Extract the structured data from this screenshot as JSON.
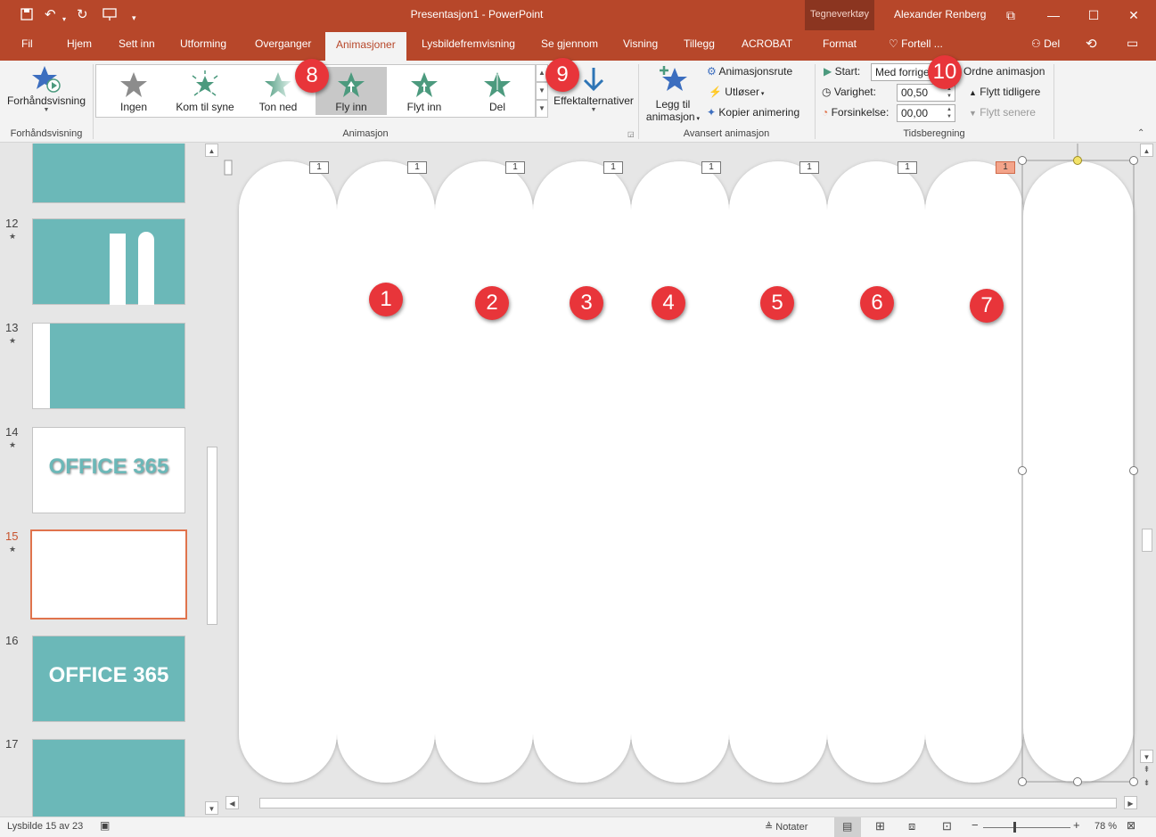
{
  "window": {
    "title": "Presentasjon1  -  PowerPoint",
    "context_group": "Tegneverktøy",
    "user": "Alexander Renberg"
  },
  "tabs": [
    "Fil",
    "Hjem",
    "Sett inn",
    "Utforming",
    "Overganger",
    "Animasjoner",
    "Lysbildefremvisning",
    "Se gjennom",
    "Visning",
    "Tillegg",
    "ACROBAT",
    "Format"
  ],
  "active_tab": "Animasjoner",
  "tell_me": "Fortell ...",
  "share": "Del",
  "ribbon": {
    "preview": {
      "label": "Forhåndsvisning",
      "group": "Forhåndsvisning"
    },
    "animation": {
      "group": "Animasjon",
      "gallery": [
        {
          "label": "Ingen",
          "color": "#8c8c8c"
        },
        {
          "label": "Kom til syne",
          "color": "#4c9a7e"
        },
        {
          "label": "Ton ned",
          "color": "#9fcab8"
        },
        {
          "label": "Fly inn",
          "color": "#4c9a7e"
        },
        {
          "label": "Flyt inn",
          "color": "#4c9a7e"
        },
        {
          "label": "Del",
          "color": "#4c9a7e"
        }
      ],
      "selected": "Fly inn",
      "effect_options": "Effektalternativer"
    },
    "advanced": {
      "group": "Avansert animasjon",
      "add_animation_line1": "Legg til",
      "add_animation_line2": "animasjon",
      "pane": "Animasjonsrute",
      "trigger": "Utløser",
      "copy": "Kopier animering"
    },
    "timing": {
      "group": "Tidsberegning",
      "start_label": "Start:",
      "start_value": "Med forrige",
      "duration_label": "Varighet:",
      "duration_value": "00,50",
      "delay_label": "Forsinkelse:",
      "delay_value": "00,00",
      "reorder": "Ordne animasjon",
      "move_earlier": "Flytt tidligere",
      "move_later": "Flytt senere"
    }
  },
  "slides": [
    {
      "num": "",
      "style": "teal",
      "text": ""
    },
    {
      "num": "12",
      "style": "teal-bars",
      "text": ""
    },
    {
      "num": "13",
      "style": "teal-left-white",
      "text": ""
    },
    {
      "num": "14",
      "style": "white-text",
      "text": "OFFICE 365"
    },
    {
      "num": "15",
      "style": "white",
      "text": "",
      "selected": true
    },
    {
      "num": "16",
      "style": "teal-text",
      "text": "OFFICE 365"
    },
    {
      "num": "17",
      "style": "teal",
      "text": ""
    }
  ],
  "canvas": {
    "tags": [
      "1",
      "1",
      "1",
      "1",
      "1",
      "1",
      "1",
      "1"
    ],
    "numbers": [
      "1",
      "2",
      "3",
      "4",
      "5",
      "6",
      "7"
    ]
  },
  "callouts": [
    "8",
    "9",
    "10"
  ],
  "status": {
    "slide_info": "Lysbilde 15 av 23",
    "notes": "Notater",
    "zoom": "78 %"
  },
  "colors": {
    "accent": "#b7472a",
    "teal": "#6bb8b8",
    "badge": "#e8353a"
  }
}
